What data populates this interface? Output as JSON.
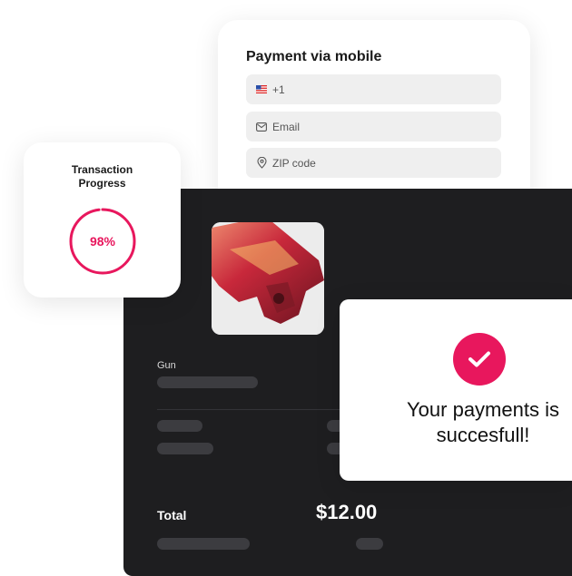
{
  "payment_form": {
    "title": "Payment via mobile",
    "phone": {
      "value": "+1",
      "icon": "us-flag-icon"
    },
    "email": {
      "placeholder": "Email",
      "icon": "mail-icon"
    },
    "zip": {
      "placeholder": "ZIP code",
      "icon": "location-pin-icon"
    }
  },
  "transaction_progress": {
    "title_line1": "Transaction",
    "title_line2": "Progress",
    "percent": 98,
    "percent_label": "98%",
    "color": "#e8175d"
  },
  "order": {
    "product_label": "Gun",
    "total_label": "Total",
    "total_value": "$12.00"
  },
  "success": {
    "line1": "Your payments is",
    "line2": "succesfull!",
    "icon": "checkmark-icon",
    "color": "#e8175d"
  },
  "colors": {
    "accent": "#e8175d",
    "panel_dark": "#1e1e20",
    "field_bg": "#efefef"
  }
}
